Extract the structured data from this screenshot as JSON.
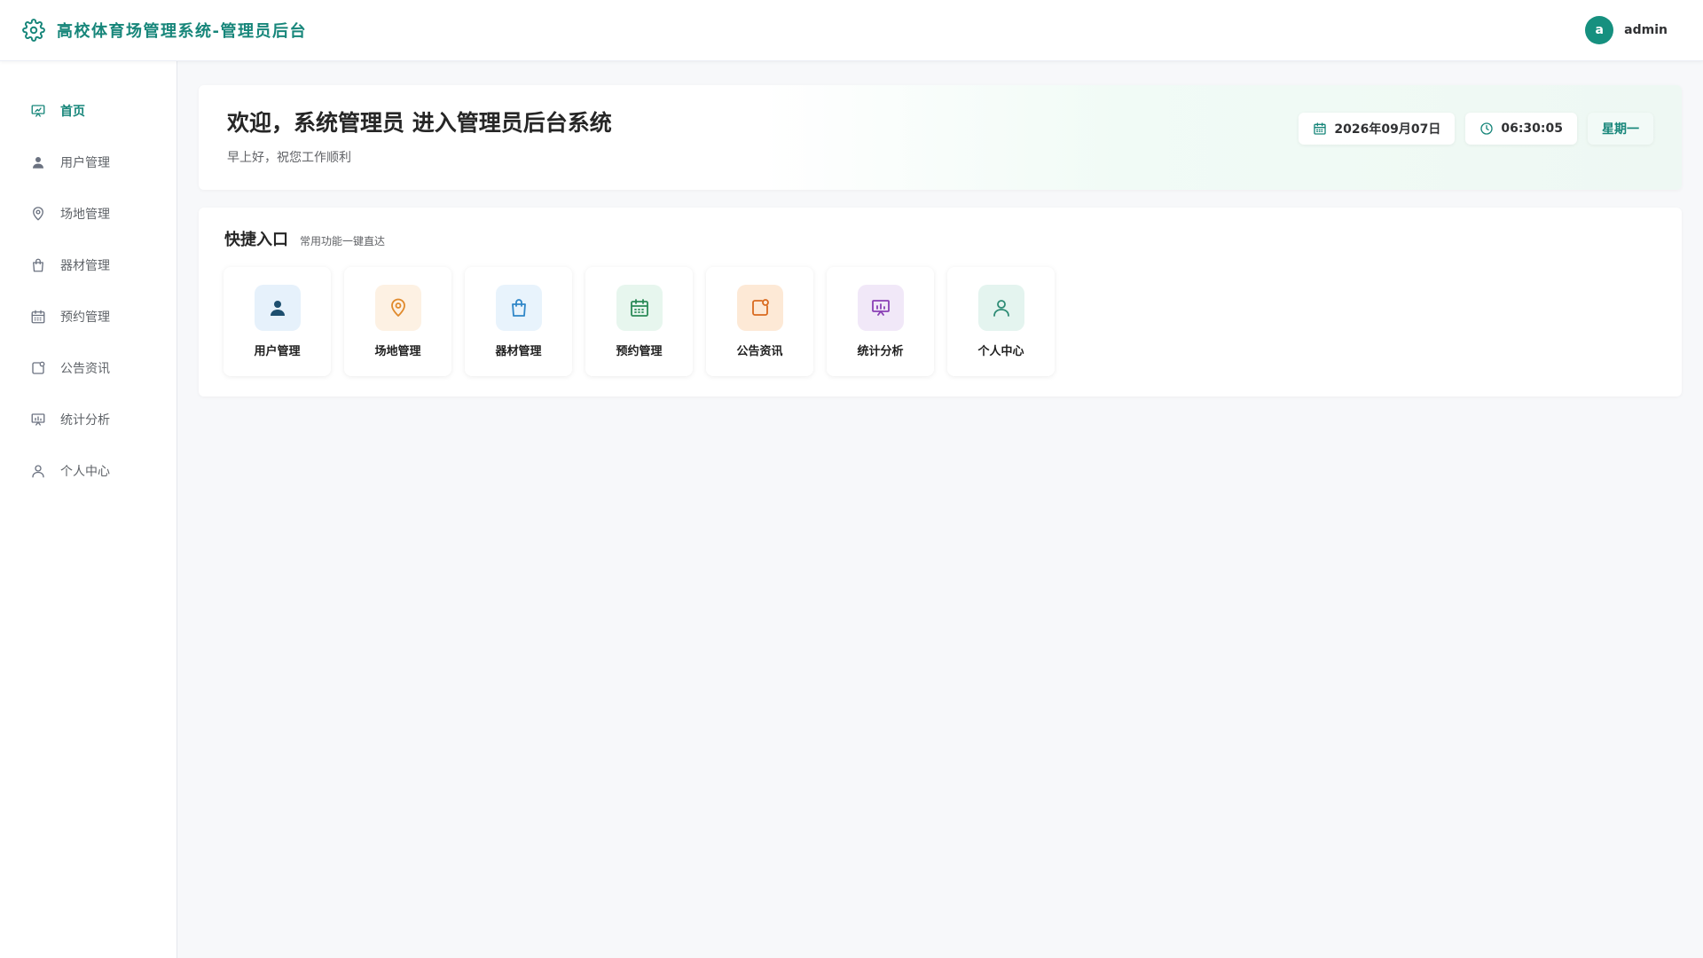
{
  "header": {
    "title": "高校体育场管理系统-管理员后台",
    "user": {
      "avatar_letter": "a",
      "name": "admin"
    },
    "icons": {
      "brand": "gear-icon"
    },
    "brand_color": "#17867a"
  },
  "sidebar": {
    "items": [
      {
        "label": "首页",
        "icon": "presentation-icon",
        "active": true
      },
      {
        "label": "用户管理",
        "icon": "user-filled-icon",
        "active": false
      },
      {
        "label": "场地管理",
        "icon": "location-pin-icon",
        "active": false
      },
      {
        "label": "器材管理",
        "icon": "shopping-bag-icon",
        "active": false
      },
      {
        "label": "预约管理",
        "icon": "calendar-icon",
        "active": false
      },
      {
        "label": "公告资讯",
        "icon": "notification-icon",
        "active": false
      },
      {
        "label": "统计分析",
        "icon": "chart-board-icon",
        "active": false
      },
      {
        "label": "个人中心",
        "icon": "user-outline-icon",
        "active": false
      }
    ]
  },
  "welcome": {
    "title": "欢迎，系统管理员 进入管理员后台系统",
    "subtitle": "早上好，祝您工作顺利",
    "date": "2026年09月07日",
    "time": "06:30:05",
    "weekday": "星期一"
  },
  "quick": {
    "title": "快捷入口",
    "subtitle": "常用功能一键直达",
    "items": [
      {
        "label": "用户管理",
        "icon": "user-filled-icon",
        "bg": "#e6f1fb",
        "color": "#1d4e6e"
      },
      {
        "label": "场地管理",
        "icon": "location-pin-icon",
        "bg": "#fdf1e3",
        "color": "#e08a2c"
      },
      {
        "label": "器材管理",
        "icon": "shopping-bag-icon",
        "bg": "#e8f3fc",
        "color": "#2f86c8"
      },
      {
        "label": "预约管理",
        "icon": "calendar-icon",
        "bg": "#e7f6ee",
        "color": "#2b8a57"
      },
      {
        "label": "公告资讯",
        "icon": "notification-icon",
        "bg": "#fde9d6",
        "color": "#d96a1f"
      },
      {
        "label": "统计分析",
        "icon": "chart-board-icon",
        "bg": "#f1e8f8",
        "color": "#8a3fb5"
      },
      {
        "label": "个人中心",
        "icon": "user-outline-icon",
        "bg": "#e4f4ef",
        "color": "#2c8b74"
      }
    ]
  }
}
